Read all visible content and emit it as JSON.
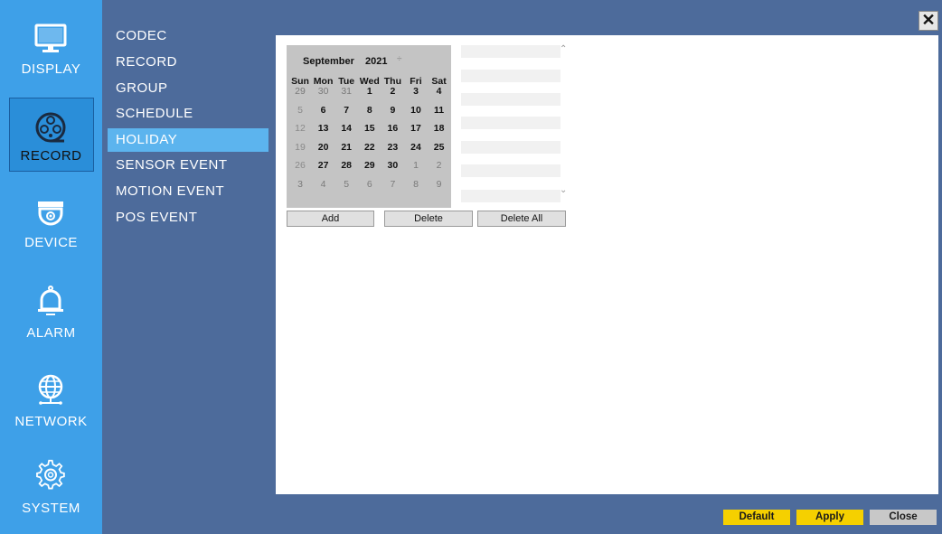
{
  "categories": [
    {
      "label": "DISPLAY",
      "icon": "monitor-icon",
      "active": false
    },
    {
      "label": "RECORD",
      "icon": "film-reel-icon",
      "active": true
    },
    {
      "label": "DEVICE",
      "icon": "dome-camera-icon",
      "active": false
    },
    {
      "label": "ALARM",
      "icon": "bell-icon",
      "active": false
    },
    {
      "label": "NETWORK",
      "icon": "globe-icon",
      "active": false
    },
    {
      "label": "SYSTEM",
      "icon": "gear-icon",
      "active": false
    }
  ],
  "submenu": {
    "items": [
      "CODEC",
      "RECORD",
      "GROUP",
      "SCHEDULE",
      "HOLIDAY",
      "SENSOR EVENT",
      "MOTION EVENT",
      "POS EVENT"
    ],
    "selected": "HOLIDAY"
  },
  "close_glyph": "✕",
  "calendar": {
    "month": "September",
    "year": "2021",
    "spin_glyph": "÷",
    "weekdays": [
      "Sun",
      "Mon",
      "Tue",
      "Wed",
      "Thu",
      "Fri",
      "Sat"
    ],
    "weeks": [
      [
        "29",
        "30",
        "31",
        "1",
        "2",
        "3",
        "4"
      ],
      [
        "5",
        "6",
        "7",
        "8",
        "9",
        "10",
        "11"
      ],
      [
        "12",
        "13",
        "14",
        "15",
        "16",
        "17",
        "18"
      ],
      [
        "19",
        "20",
        "21",
        "22",
        "23",
        "24",
        "25"
      ],
      [
        "26",
        "27",
        "28",
        "29",
        "30",
        "1",
        "2"
      ],
      [
        "3",
        "4",
        "5",
        "6",
        "7",
        "8",
        "9"
      ]
    ]
  },
  "holiday_list": {
    "scroll_up_glyph": "⌃",
    "scroll_down_glyph": "⌄"
  },
  "buttons": {
    "add": "Add",
    "delete": "Delete",
    "delete_all": "Delete All"
  },
  "footer": {
    "default": "Default",
    "apply": "Apply",
    "close": "Close"
  },
  "colors": {
    "left_bar": "#3ea0e8",
    "panel": "#4d6b9b",
    "highlight": "#5cb4ee",
    "apply_button": "#f5d000",
    "close_button": "#c8c8c8"
  }
}
